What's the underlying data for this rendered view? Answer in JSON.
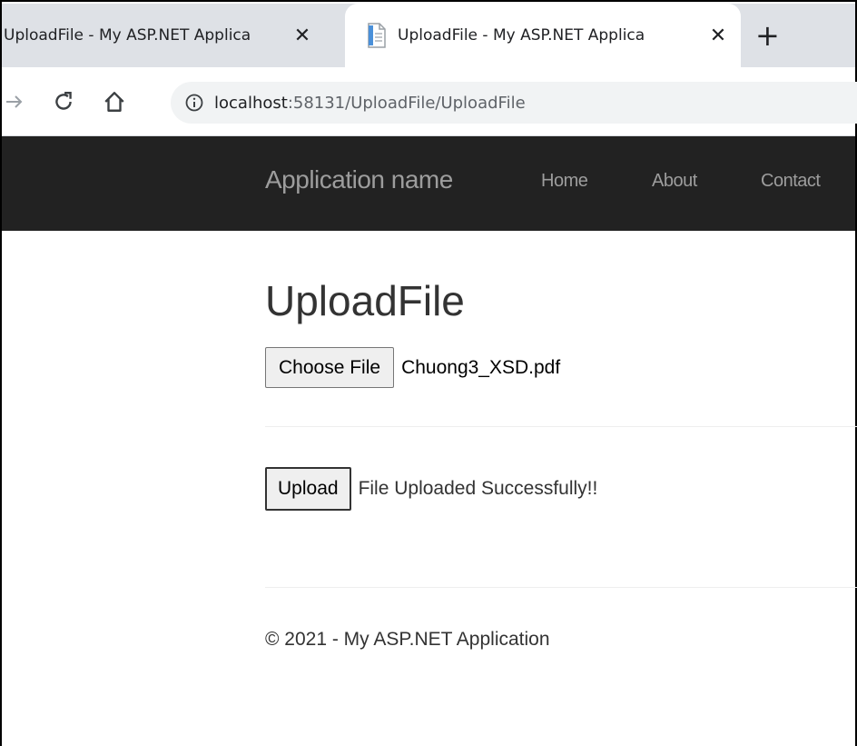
{
  "browser": {
    "tabs": [
      {
        "title": "UploadFile - My ASP.NET Applica",
        "active": false
      },
      {
        "title": "UploadFile - My ASP.NET Applica",
        "active": true
      }
    ],
    "close_glyph": "✕",
    "new_tab_glyph": "+",
    "url_host": "localhost",
    "url_path": ":58131/UploadFile/UploadFile"
  },
  "navbar": {
    "brand": "Application name",
    "links": [
      "Home",
      "About",
      "Contact"
    ]
  },
  "main": {
    "title": "UploadFile",
    "choose_file_label": "Choose File",
    "selected_file": "Chuong3_XSD.pdf",
    "upload_label": "Upload",
    "status_message": "File Uploaded Successfully!!"
  },
  "footer": {
    "text": "© 2021 - My ASP.NET Application"
  },
  "colors": {
    "navbar_bg": "#222222",
    "navbar_text": "#9d9d9d",
    "tabstrip_bg": "#dee1e6",
    "omnibox_bg": "#f1f3f4"
  }
}
